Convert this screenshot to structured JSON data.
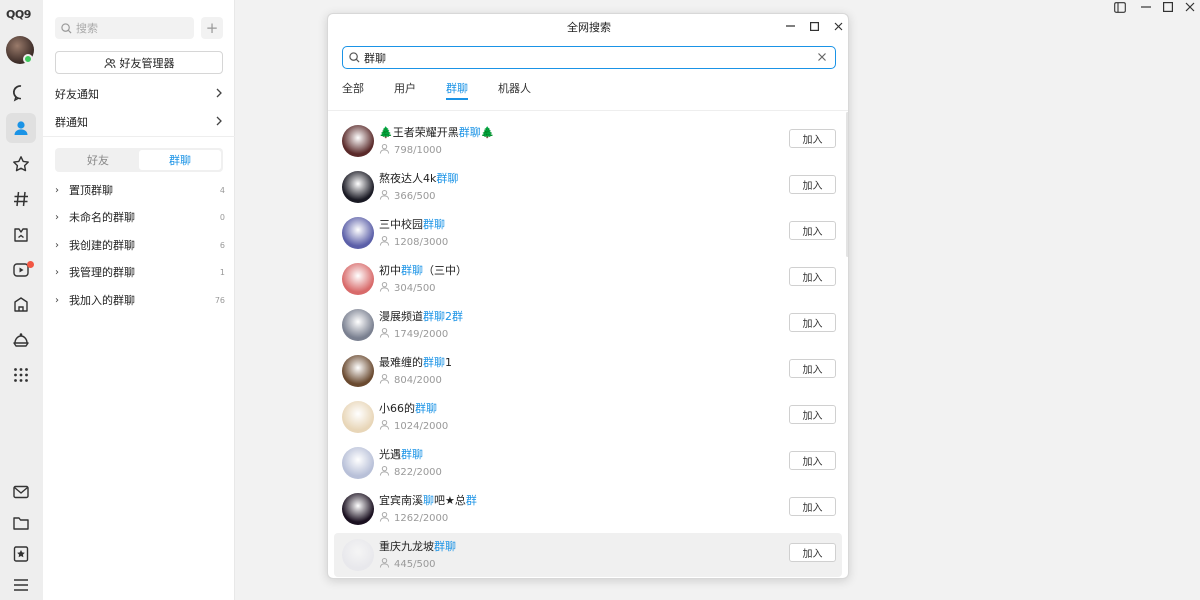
{
  "app": {
    "logo": "QQ9"
  },
  "contacts": {
    "search_placeholder": "搜索",
    "manager_button": "好友管理器",
    "notices": [
      {
        "label": "好友通知"
      },
      {
        "label": "群通知"
      }
    ],
    "segment": {
      "friends": "好友",
      "groups": "群聊"
    },
    "groups": [
      {
        "label": "置顶群聊",
        "count": "4"
      },
      {
        "label": "未命名的群聊",
        "count": "0"
      },
      {
        "label": "我创建的群聊",
        "count": "6"
      },
      {
        "label": "我管理的群聊",
        "count": "1"
      },
      {
        "label": "我加入的群聊",
        "count": "76"
      }
    ]
  },
  "dialog": {
    "title": "全网搜索",
    "search_value": "群聊",
    "tabs": [
      "全部",
      "用户",
      "群聊",
      "机器人"
    ],
    "active_tab": "群聊",
    "join_label": "加入",
    "results": [
      {
        "name": [
          [
            "🌲王者荣耀开黑",
            0
          ],
          [
            "群聊",
            1
          ],
          [
            "🌲",
            0
          ]
        ],
        "members": "798/1000",
        "color": "#5a2a2a"
      },
      {
        "name": [
          [
            "熬夜达人4k",
            0
          ],
          [
            "群聊",
            1
          ]
        ],
        "members": "366/500",
        "color": "#1a1a24"
      },
      {
        "name": [
          [
            "三中校园",
            0
          ],
          [
            "群聊",
            1
          ]
        ],
        "members": "1208/3000",
        "color": "#5b5fa8"
      },
      {
        "name": [
          [
            "初中",
            0
          ],
          [
            "群聊",
            1
          ],
          [
            "（三中）",
            0
          ]
        ],
        "members": "304/500",
        "color": "#d86a6a"
      },
      {
        "name": [
          [
            "漫展频道",
            0
          ],
          [
            "群聊2群",
            1
          ]
        ],
        "members": "1749/2000",
        "color": "#7a8090"
      },
      {
        "name": [
          [
            "最难缠的",
            0
          ],
          [
            "群聊",
            1
          ],
          [
            "1",
            0
          ]
        ],
        "members": "804/2000",
        "color": "#6a4a30"
      },
      {
        "name": [
          [
            "小66的",
            0
          ],
          [
            "群聊",
            1
          ]
        ],
        "members": "1024/2000",
        "color": "#e8d6b8"
      },
      {
        "name": [
          [
            "光遇",
            0
          ],
          [
            "群聊",
            1
          ]
        ],
        "members": "822/2000",
        "color": "#b8c0d8"
      },
      {
        "name": [
          [
            "宜宾南溪",
            0
          ],
          [
            "聊",
            1
          ],
          [
            "吧★总",
            0
          ],
          [
            "群",
            1
          ]
        ],
        "members": "1262/2000",
        "color": "#1a1020"
      },
      {
        "name": [
          [
            "重庆九龙坡",
            0
          ],
          [
            "群聊",
            1
          ]
        ],
        "members": "445/500",
        "color": "#e8e8ec"
      }
    ]
  }
}
